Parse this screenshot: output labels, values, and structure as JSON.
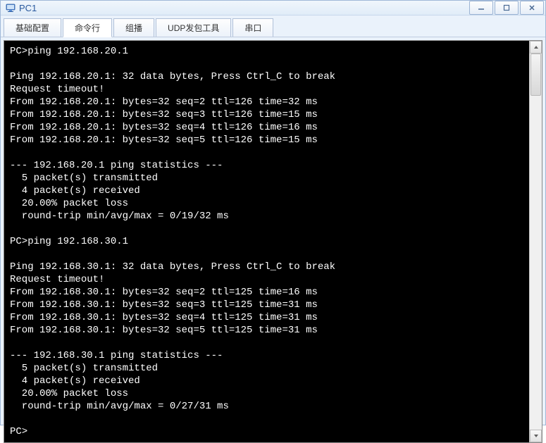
{
  "window": {
    "title": "PC1"
  },
  "tabs": {
    "t0": "基础配置",
    "t1": "命令行",
    "t2": "组播",
    "t3": "UDP发包工具",
    "t4": "串口"
  },
  "terminal": {
    "content": "PC>ping 192.168.20.1\n\nPing 192.168.20.1: 32 data bytes, Press Ctrl_C to break\nRequest timeout!\nFrom 192.168.20.1: bytes=32 seq=2 ttl=126 time=32 ms\nFrom 192.168.20.1: bytes=32 seq=3 ttl=126 time=15 ms\nFrom 192.168.20.1: bytes=32 seq=4 ttl=126 time=16 ms\nFrom 192.168.20.1: bytes=32 seq=5 ttl=126 time=15 ms\n\n--- 192.168.20.1 ping statistics ---\n  5 packet(s) transmitted\n  4 packet(s) received\n  20.00% packet loss\n  round-trip min/avg/max = 0/19/32 ms\n\nPC>ping 192.168.30.1\n\nPing 192.168.30.1: 32 data bytes, Press Ctrl_C to break\nRequest timeout!\nFrom 192.168.30.1: bytes=32 seq=2 ttl=125 time=16 ms\nFrom 192.168.30.1: bytes=32 seq=3 ttl=125 time=31 ms\nFrom 192.168.30.1: bytes=32 seq=4 ttl=125 time=31 ms\nFrom 192.168.30.1: bytes=32 seq=5 ttl=125 time=31 ms\n\n--- 192.168.30.1 ping statistics ---\n  5 packet(s) transmitted\n  4 packet(s) received\n  20.00% packet loss\n  round-trip min/avg/max = 0/27/31 ms\n\nPC>"
  }
}
